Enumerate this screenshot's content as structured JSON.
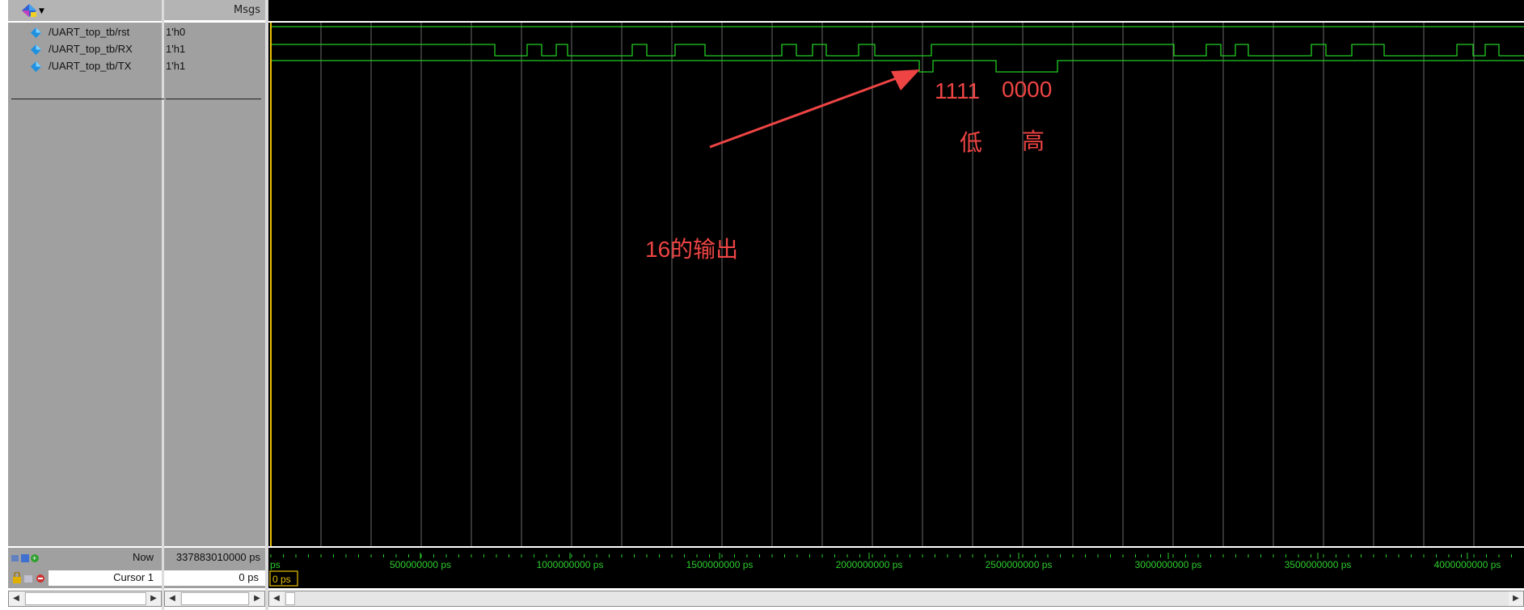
{
  "header": {
    "msgs_label": "Msgs"
  },
  "signals": [
    {
      "name": "/UART_top_tb/rst",
      "value": "1'h0"
    },
    {
      "name": "/UART_top_tb/RX",
      "value": "1'h1"
    },
    {
      "name": "/UART_top_tb/TX",
      "value": "1'h1"
    }
  ],
  "footer": {
    "now_label": "Now",
    "now_value": "337883010000 ps",
    "cursor_label": "Cursor 1",
    "cursor_value": "0 ps",
    "cursor_time_tag": "0 ps"
  },
  "timeline": {
    "start_label": "ps",
    "ticks": [
      {
        "t": 500000000,
        "label": "500000000 ps"
      },
      {
        "t": 1000000000,
        "label": "1000000000 ps"
      },
      {
        "t": 1500000000,
        "label": "1500000000 ps"
      },
      {
        "t": 2000000000,
        "label": "2000000000 ps"
      },
      {
        "t": 2500000000,
        "label": "2500000000 ps"
      },
      {
        "t": 3000000000,
        "label": "3000000000 ps"
      },
      {
        "t": 3500000000,
        "label": "3500000000 ps"
      },
      {
        "t": 4000000000,
        "label": "4000000000 ps"
      }
    ]
  },
  "annotations": {
    "bits_low": "1111",
    "bits_high": "0000",
    "label_low": "低",
    "label_high": "高",
    "arrow_note": "16的输出"
  },
  "colors": {
    "wave_green": "#22cc22",
    "grid": "#6a6a6a",
    "cursor": "#e8c000",
    "annotation_red": "#ee4444",
    "timeline_text": "#2ecc2e"
  },
  "icons": {
    "header_logo": "wave-add-icon",
    "signal_marker": "signal-diamond-icon",
    "zoom_icons": "zoom-tool-icons",
    "lock_icons": "cursor-lock-icons"
  }
}
